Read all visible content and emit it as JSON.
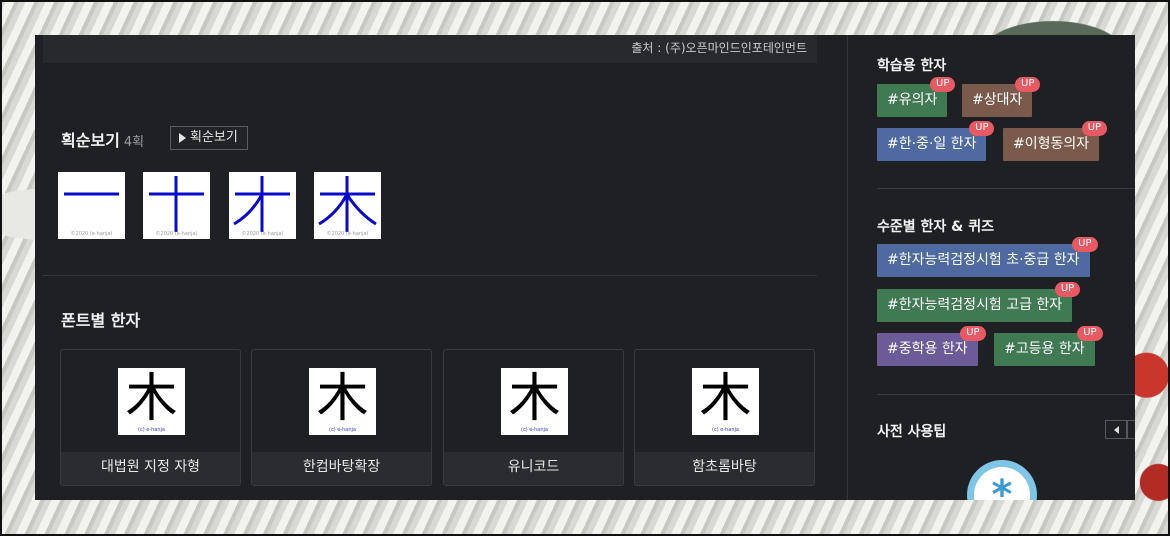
{
  "notice": {
    "text": "출처 : (주)오픈마인드인포테인먼트"
  },
  "stroke_section": {
    "title": "획순보기",
    "count": "4획",
    "button_label": "획순보기",
    "copyright": "©2020 (e-hanja)"
  },
  "font_section": {
    "title": "폰트별 한자",
    "glyph": "木",
    "copyright": "(c) e-hanja",
    "cards": [
      {
        "label": "대법원 지정 자형"
      },
      {
        "label": "한컴바탕확장"
      },
      {
        "label": "유니코드"
      },
      {
        "label": "함초롬바탕"
      }
    ]
  },
  "sidebar": {
    "learning": {
      "title": "학습용 한자",
      "tags": [
        {
          "label": "#유의자",
          "badge": "UP"
        },
        {
          "label": "#상대자",
          "badge": "UP"
        },
        {
          "label": "#한·중·일 한자",
          "badge": "UP"
        },
        {
          "label": "#이형동의자",
          "badge": "UP"
        }
      ]
    },
    "level": {
      "title": "수준별 한자 & 퀴즈",
      "tags": [
        {
          "label": "#한자능력검정시험 초·중급 한자",
          "badge": "UP"
        },
        {
          "label": "#한자능력검정시험 고급 한자",
          "badge": "UP"
        },
        {
          "label": "#중학용 한자",
          "badge": "UP"
        },
        {
          "label": "#고등용 한자",
          "badge": "UP"
        }
      ]
    },
    "tips": {
      "title": "사전 사용팁",
      "icon_glyph": "*"
    }
  },
  "colors": {
    "panel": "#1f2023",
    "tag_green": "#3f7a53",
    "tag_brown": "#7a5a4a",
    "tag_blue": "#4e6aa0",
    "tag_purple": "#6d5a98",
    "badge": "#e85a63",
    "stroke_blue": "#0a0acd"
  },
  "icons": [
    "play-icon",
    "arrow-left-icon",
    "arrow-right-icon",
    "tip-star-icon"
  ]
}
